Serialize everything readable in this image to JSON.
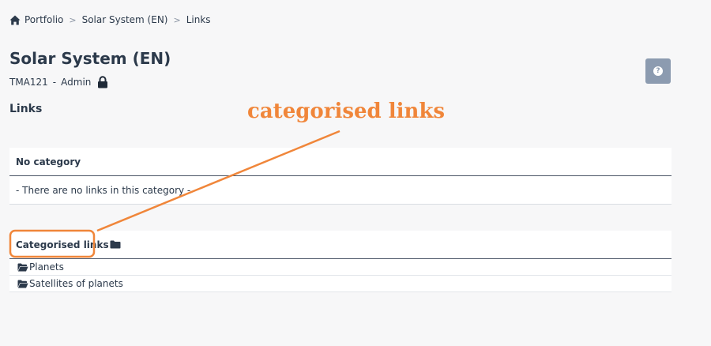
{
  "breadcrumb": {
    "items": [
      "Portfolio",
      "Solar System (EN)",
      "Links"
    ],
    "separator": ">"
  },
  "page": {
    "title": "Solar System (EN)",
    "course_code": "TMA121",
    "course_dash": "-",
    "role": "Admin",
    "section_title": "Links"
  },
  "help_button": {
    "icon": "question-icon",
    "glyph": "?"
  },
  "annotation": {
    "text": "categorised links",
    "color": "#f0863a"
  },
  "no_category": {
    "heading": "No category",
    "empty_message": "- There are no links in this category -"
  },
  "categorised": {
    "heading": "Categorised links",
    "items": [
      {
        "label": "Planets",
        "icon": "folder-open-icon"
      },
      {
        "label": "Satellites of planets",
        "icon": "folder-open-icon"
      }
    ]
  },
  "colors": {
    "text": "#2c3a4b",
    "background": "#f7f7f8",
    "help_button": "#8c9bb0",
    "annotation": "#f0863a"
  }
}
